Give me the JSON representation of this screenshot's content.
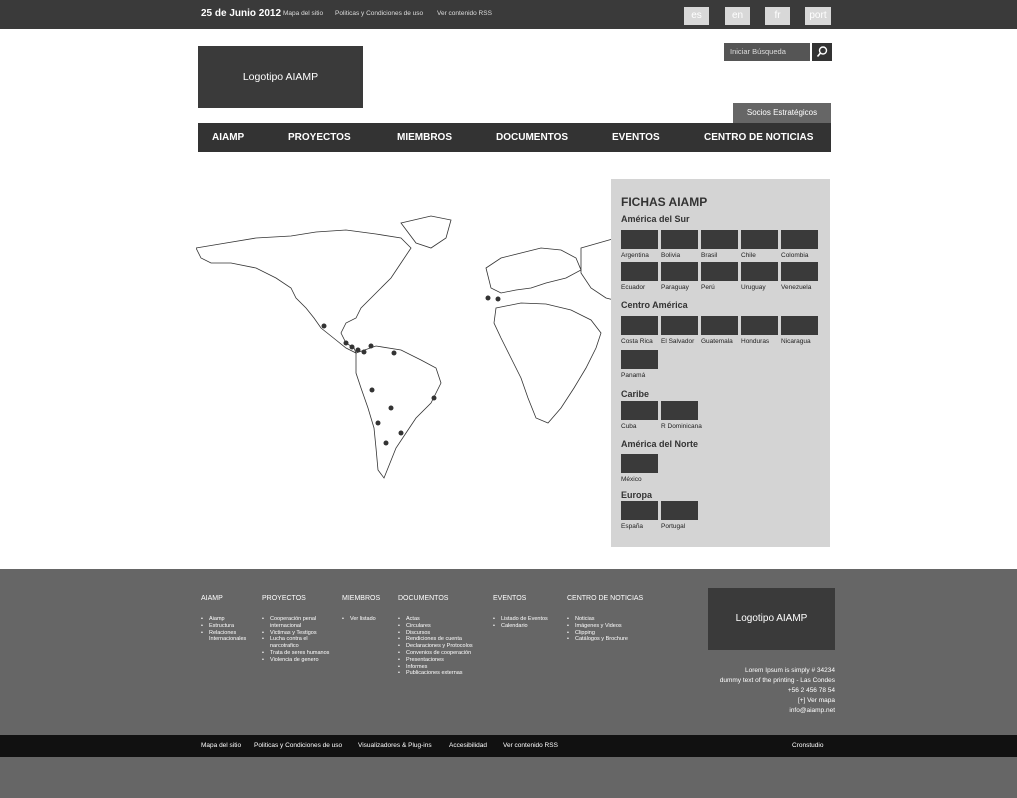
{
  "topbar": {
    "date": "25 de Junio 2012",
    "links": [
      "Mapa del sitio",
      "Politicas y Condiciones de uso",
      "Ver contenido RSS"
    ],
    "languages": [
      "es",
      "en",
      "fr",
      "port"
    ]
  },
  "header": {
    "logo": "Logotipo AIAMP",
    "search_placeholder": "Iniciar Búsqueda",
    "socios": "Socios Estratégicos"
  },
  "nav": [
    "AIAMP",
    "PROYECTOS",
    "MIEMBROS",
    "DOCUMENTOS",
    "EVENTOS",
    "CENTRO DE NOTICIAS"
  ],
  "fichas": {
    "title": "FICHAS AIAMP",
    "regions": [
      {
        "name": "América del Sur",
        "countries": [
          "Argentina",
          "Bolivia",
          "Brasil",
          "Chile",
          "Colombia",
          "Ecuador",
          "Paraguay",
          "Perú",
          "Uruguay",
          "Venezuela"
        ]
      },
      {
        "name": "Centro América",
        "countries": [
          "Costa Rica",
          "El Salvador",
          "Guatemala",
          "Honduras",
          "Nicaragua",
          "Panamá"
        ]
      },
      {
        "name": "Caribe",
        "countries": [
          "Cuba",
          "R Dominicana"
        ]
      },
      {
        "name": "América del Norte",
        "countries": [
          "México"
        ]
      },
      {
        "name": "Europa",
        "countries": [
          "España",
          "Portugal"
        ]
      }
    ]
  },
  "footer": {
    "columns": [
      {
        "title": "AIAMP",
        "items": [
          "Aiamp",
          "Estructura",
          "Relaciones Internacionales"
        ]
      },
      {
        "title": "PROYECTOS",
        "items": [
          "Cooperación penal internacional",
          "Victimas y Testigos",
          "Lucha contra el narcotrafico",
          "Trata de seres humanos",
          "Violencia de genero"
        ]
      },
      {
        "title": "MIEMBROS",
        "items": [
          "Ver listado"
        ]
      },
      {
        "title": "DOCUMENTOS",
        "items": [
          "Actas",
          "Circulares",
          "Discursos",
          "Rendiciones de cuenta",
          "Declaraciones y Protocolos",
          "Convenios de cooperación",
          "Presentaciones",
          "Informes",
          "Publicaciones externas"
        ]
      },
      {
        "title": "EVENTOS",
        "items": [
          "Listado de Eventos",
          "Calendario"
        ]
      },
      {
        "title": "CENTRO DE NOTICIAS",
        "items": [
          "Noticias",
          "Imágenes y Videos",
          "Clipping",
          "Catálogos y Brochure"
        ]
      }
    ],
    "logo": "Logotipo AIAMP",
    "address": [
      "Lorem Ipsum is simply # 34234",
      "dummy text of the printing - Las Condes",
      "+56 2 456 78 54",
      "[+] Ver mapa",
      "info@aiamp.net"
    ]
  },
  "bottombar": {
    "links": [
      "Mapa del sitio",
      "Politicas y Condiciones de uso",
      "Visualizadores & Plug-ins",
      "Accesibilidad",
      "Ver contenido RSS"
    ],
    "credit": "Cronstudio"
  }
}
